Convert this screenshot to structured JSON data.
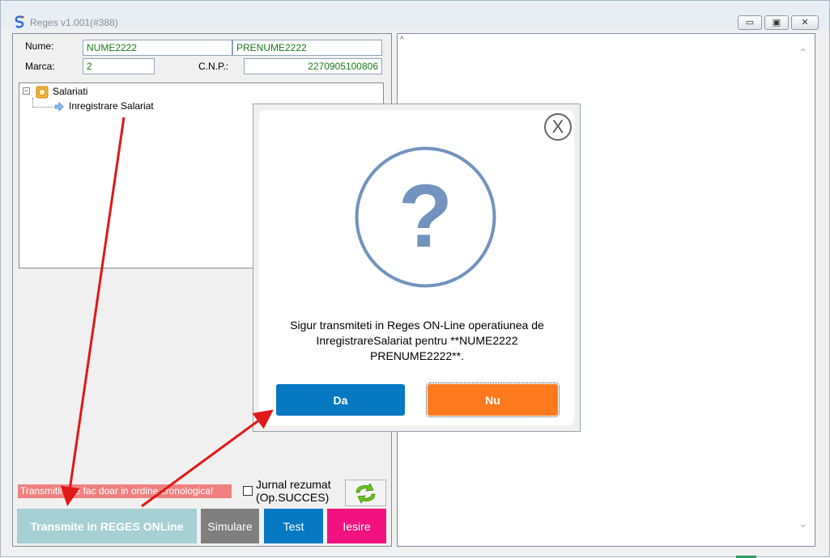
{
  "window": {
    "title": "Reges v1.001(#388)",
    "minimize_glyph": "▭",
    "maximize_glyph": "▣",
    "close_glyph": "✕"
  },
  "form": {
    "nume_label": "Nume:",
    "nume_value": "NUME2222",
    "prenume_value": "PRENUME2222",
    "marca_label": "Marca:",
    "marca_value": "2",
    "cnp_label": "C.N.P.:",
    "cnp_value": "2270905100806"
  },
  "tree": {
    "toggle": "−",
    "root_label": "Salariati",
    "child_label": "Inregistrare Salariat"
  },
  "bottom": {
    "warning_text": "Transmitile se fac doar in ordine cronologica!",
    "jurnal_label": "Jurnal rezumat (Op.SUCCES)",
    "jurnal_checked": false,
    "transmite_label": "Transmite in REGES ONLine",
    "simulare_label": "Simulare",
    "test_label": "Test",
    "iesire_label": "Iesire"
  },
  "right_panel": {
    "caret": "^",
    "scroll_up": "⌃",
    "scroll_down": "⌄"
  },
  "dialog": {
    "close_label": "X",
    "question_mark": "?",
    "message_line1": "Sigur transmiteti in Reges ON-Line operatiunea de",
    "message_line2": "InregistrareSalariat pentru **NUME2222",
    "message_line3": "PRENUME2222**.",
    "yes_label": "Da",
    "no_label": "Nu"
  },
  "colors": {
    "transmite_bg": "#a6d0d3",
    "simulare_bg": "#7f7f7f",
    "test_bg": "#0679c2",
    "iesire_bg": "#f1127f",
    "yes_bg": "#0679c2",
    "no_bg": "#ff7a1f",
    "question_color": "#7393be",
    "annotation_arrow": "#e01818",
    "warning_bg": "#f08080"
  },
  "icons": {
    "app": "reges-logo-icon",
    "root_node": "folder-orange-icon",
    "child_node": "arrow-right-icon",
    "refresh": "refresh-arrows-icon",
    "question": "question-circle-icon"
  }
}
